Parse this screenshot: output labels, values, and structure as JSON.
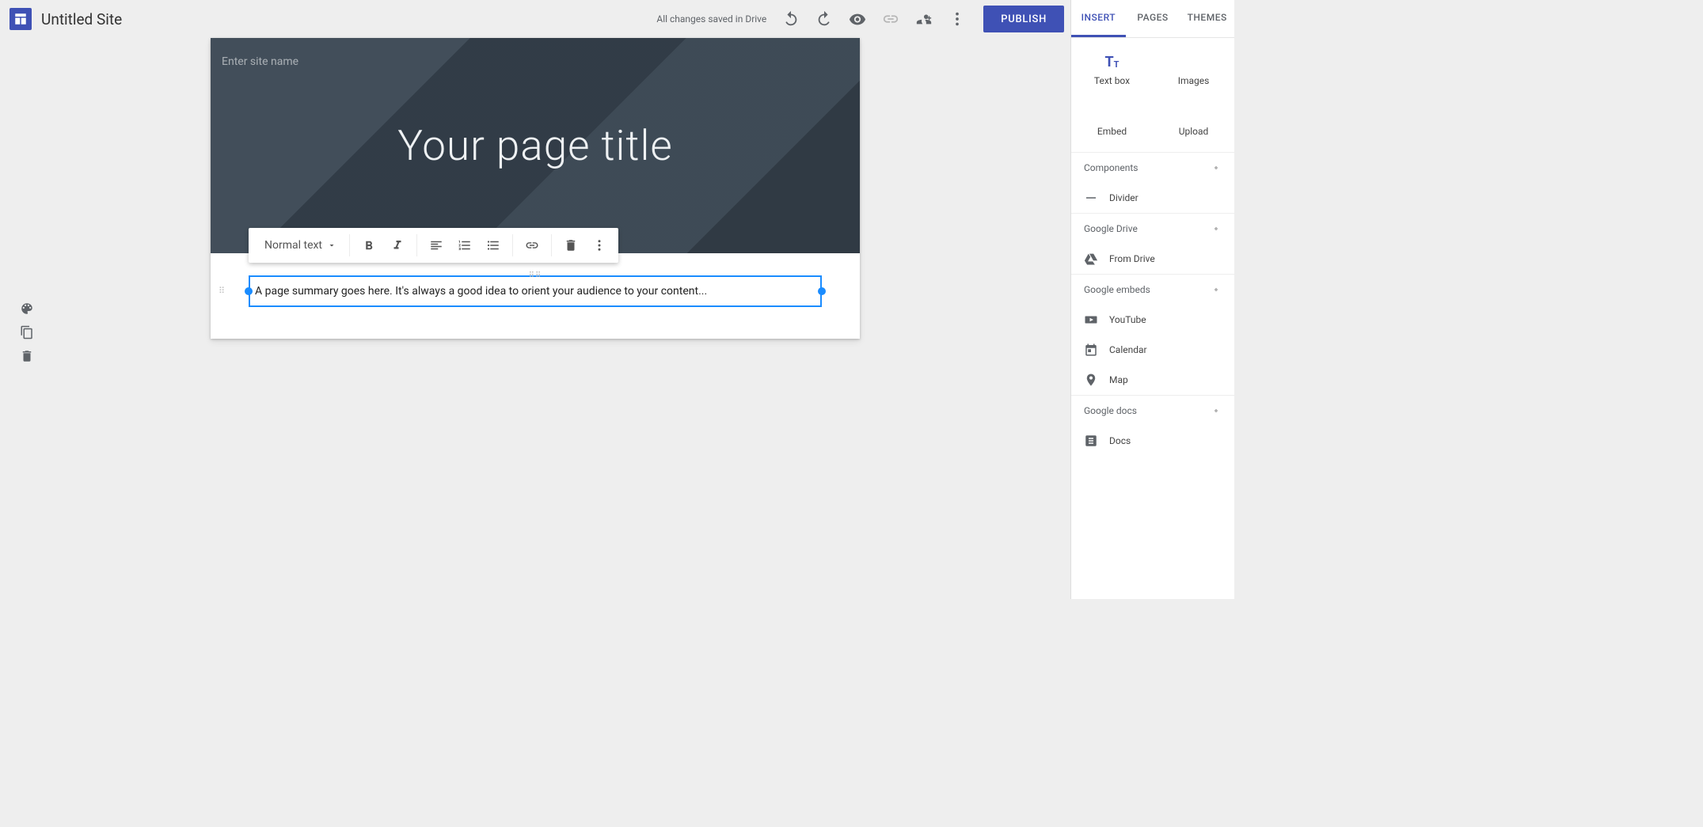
{
  "topbar": {
    "site_title": "Untitled Site",
    "status_text": "All changes saved in Drive",
    "publish_label": "PUBLISH"
  },
  "hero": {
    "site_name_placeholder": "Enter site name",
    "page_title": "Your page title"
  },
  "toolbar": {
    "text_style_label": "Normal text"
  },
  "textbox": {
    "content": "A page summary goes here. It's always a good idea to orient your audience to your content..."
  },
  "rightpanel": {
    "tabs": {
      "insert": "INSERT",
      "pages": "PAGES",
      "themes": "THEMES"
    },
    "insert_items": {
      "textbox": "Text box",
      "images": "Images",
      "embed": "Embed",
      "upload": "Upload"
    },
    "sections": {
      "components": "Components",
      "google_drive": "Google Drive",
      "google_embeds": "Google embeds",
      "google_docs": "Google docs"
    },
    "rows": {
      "divider": "Divider",
      "from_drive": "From Drive",
      "youtube": "YouTube",
      "calendar": "Calendar",
      "map": "Map",
      "docs": "Docs"
    }
  }
}
